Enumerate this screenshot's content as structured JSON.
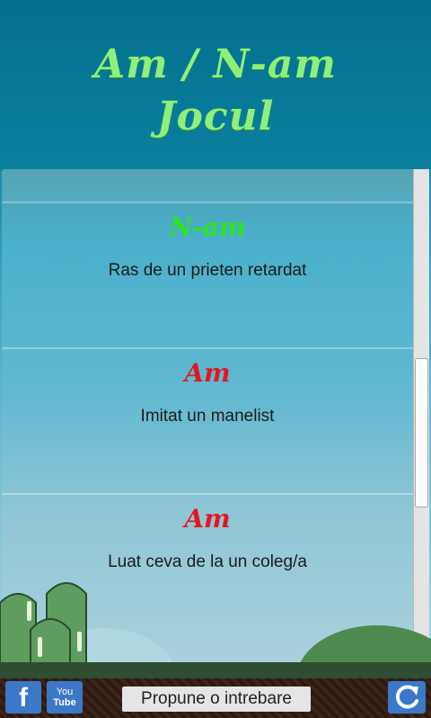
{
  "header": {
    "title_line1": "Am / N-am",
    "title_line2": "Jocul"
  },
  "items": [
    {
      "verdict": "N-am",
      "verdict_color": "#2ee51a",
      "question": "Ras de un prieten retardat"
    },
    {
      "verdict": "Am",
      "verdict_color": "#e5161f",
      "question": "Imitat un manelist"
    },
    {
      "verdict": "Am",
      "verdict_color": "#e5161f",
      "question": "Luat ceva de la un coleg/a"
    }
  ],
  "bottom_bar": {
    "facebook_label": "f",
    "youtube_label_top": "You",
    "youtube_label_bottom": "Tube",
    "propose_label": "Propune o intrebare"
  },
  "colors": {
    "title": "#8ef07a",
    "button_blue": "#3b78c8"
  }
}
